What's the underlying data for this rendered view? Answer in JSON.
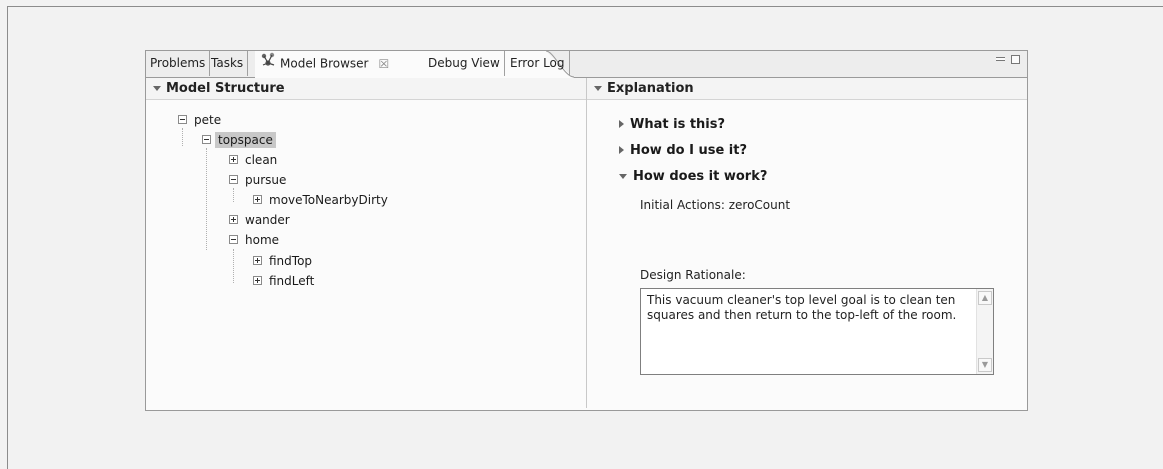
{
  "tabs": [
    {
      "label": "Problems"
    },
    {
      "label": "Tasks"
    },
    {
      "label": "Model Browser",
      "close": "☒"
    },
    {
      "label": "Debug View"
    },
    {
      "label": "Error Log"
    }
  ],
  "left_pane": {
    "title": "Model Structure"
  },
  "tree": [
    {
      "label": "pete"
    },
    {
      "label": "topspace"
    },
    {
      "label": "clean"
    },
    {
      "label": "pursue"
    },
    {
      "label": "moveToNearbyDirty"
    },
    {
      "label": "wander"
    },
    {
      "label": "home"
    },
    {
      "label": "findTop"
    },
    {
      "label": "findLeft"
    }
  ],
  "right_pane": {
    "title": "Explanation",
    "sections": [
      {
        "label": "What is this?"
      },
      {
        "label": "How do I use it?"
      },
      {
        "label": "How does it work?"
      }
    ],
    "initial_actions": "Initial Actions: zeroCount",
    "design_rationale_label": "Design Rationale:",
    "design_rationale_text": "This vacuum cleaner's top level goal is to clean ten squares and then return to the top-left of the room."
  },
  "icons": {
    "model_browser": "model-browser-icon",
    "minimize": "minimize-icon",
    "maximize": "maximize-icon"
  }
}
